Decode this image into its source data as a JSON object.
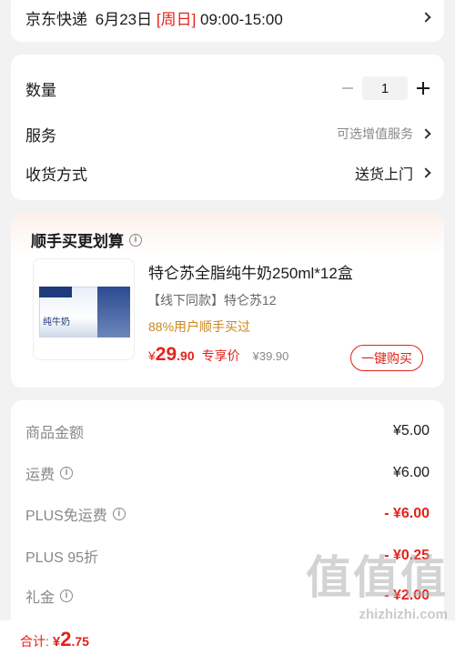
{
  "delivery": {
    "carrier": "京东快递",
    "date": "6月23日",
    "weekday": "[周日]",
    "time": "09:00-15:00"
  },
  "options": {
    "quantity_label": "数量",
    "quantity_value": "1",
    "service_label": "服务",
    "service_value": "可选增值服务",
    "shipping_label": "收货方式",
    "shipping_value": "送货上门"
  },
  "upsell": {
    "title": "顺手买更划算",
    "product": {
      "name": "特仑苏全脂纯牛奶250ml*12盒",
      "tag": "【线下同款】特仑苏12",
      "social_proof": "88%用户顺手买过",
      "price_symbol": "¥",
      "price_int": "29",
      "price_dec": ".90",
      "price_label": "专享价",
      "original_price": "¥39.90",
      "buy_button": "一键购买",
      "image_text_1": "纯牛奶"
    }
  },
  "summary": {
    "rows": [
      {
        "label": "商品金额",
        "value": "¥5.00"
      },
      {
        "label": "运费",
        "value": "¥6.00"
      },
      {
        "label": "PLUS免运费",
        "value": "- ¥6.00"
      },
      {
        "label": "PLUS 95折",
        "value": "- ¥0.25"
      },
      {
        "label": "礼金",
        "value": "- ¥2.00"
      }
    ]
  },
  "total": {
    "label": "合计:",
    "symbol": "¥",
    "int": "2",
    "dec": ".75"
  },
  "watermark": {
    "big": "值值值",
    "small": "zhizhizhi.com"
  },
  "colors": {
    "accent": "#e2231a",
    "gold": "#c8871e"
  }
}
